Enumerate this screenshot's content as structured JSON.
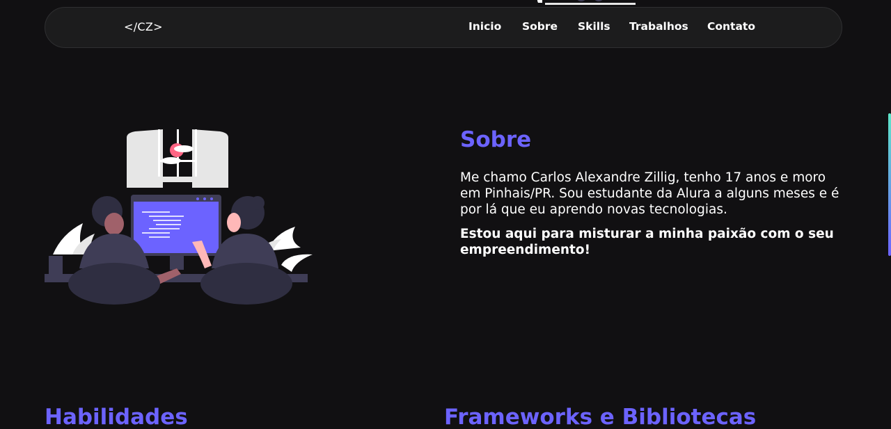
{
  "colors": {
    "background": "#111012",
    "navbar": "#1c1c1d",
    "accent": "#6c63ff",
    "text": "#ffffff"
  },
  "navbar": {
    "logo": "</CZ>",
    "links": [
      {
        "label": "Inicio"
      },
      {
        "label": "Sobre"
      },
      {
        "label": "Skills"
      },
      {
        "label": "Trabalhos"
      },
      {
        "label": "Contato"
      }
    ]
  },
  "about": {
    "title": "Sobre",
    "paragraph": "Me chamo Carlos Alexandre Zillig, tenho 17 anos e moro em Pinhais/PR. Sou estudante da Alura a alguns meses e é por lá que eu aprendo novas tecnologias.",
    "highlight": "Estou aqui para misturar a minha paixão com o seu empreendimento!"
  },
  "sections": {
    "skills_title": "Habilidades",
    "frameworks_title": "Frameworks e Bibliotecas"
  }
}
